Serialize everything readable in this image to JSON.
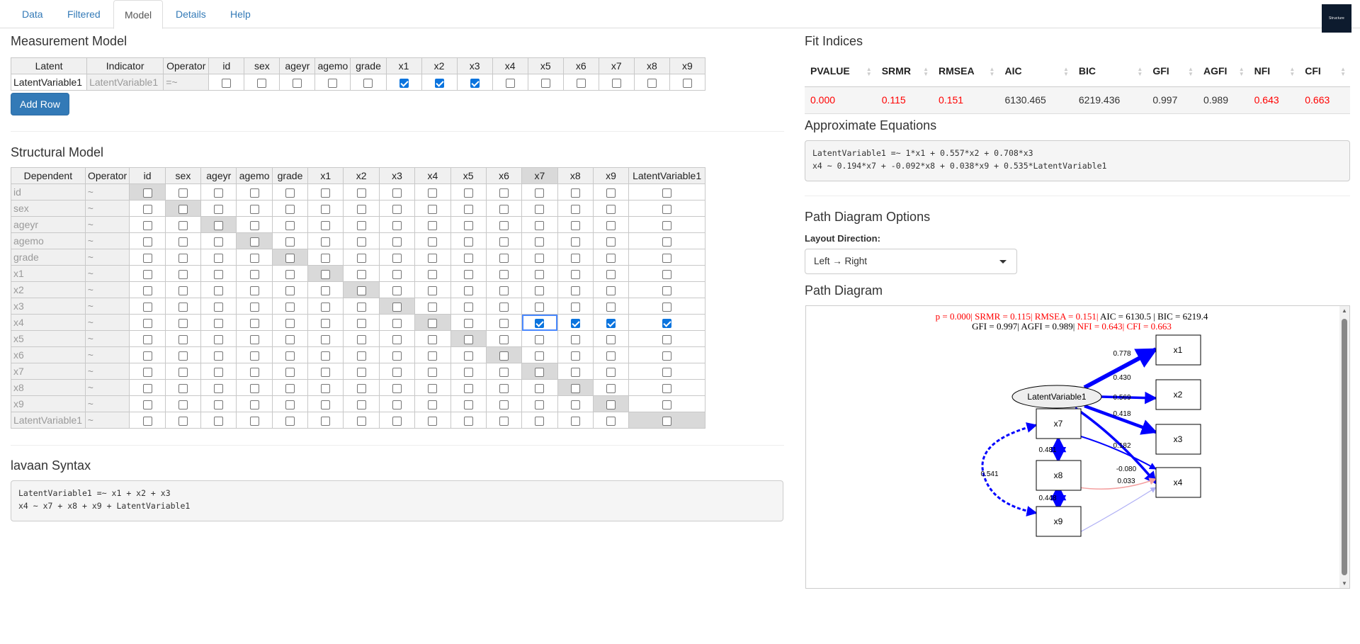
{
  "tabs": [
    "Data",
    "Filtered",
    "Model",
    "Details",
    "Help"
  ],
  "active_tab": "Model",
  "logo_text": "Structure",
  "measurement": {
    "title": "Measurement Model",
    "columns": [
      "Latent",
      "Indicator",
      "Operator",
      "id",
      "sex",
      "ageyr",
      "agemo",
      "grade",
      "x1",
      "x2",
      "x3",
      "x4",
      "x5",
      "x6",
      "x7",
      "x8",
      "x9"
    ],
    "row": {
      "latent": "LatentVariable1",
      "indicator": "LatentVariable1",
      "operator": "=~",
      "checks": [
        false,
        false,
        false,
        false,
        false,
        true,
        true,
        true,
        false,
        false,
        false,
        false,
        false,
        false
      ]
    },
    "add_row_label": "Add Row"
  },
  "structural": {
    "title": "Structural Model",
    "columns": [
      "Dependent",
      "Operator",
      "id",
      "sex",
      "ageyr",
      "agemo",
      "grade",
      "x1",
      "x2",
      "x3",
      "x4",
      "x5",
      "x6",
      "x7",
      "x8",
      "x9",
      "LatentVariable1"
    ],
    "operator": "~",
    "rows": [
      "id",
      "sex",
      "ageyr",
      "agemo",
      "grade",
      "x1",
      "x2",
      "x3",
      "x4",
      "x5",
      "x6",
      "x7",
      "x8",
      "x9",
      "LatentVariable1"
    ],
    "checked": {
      "x4": [
        "x7",
        "x8",
        "x9",
        "LatentVariable1"
      ]
    },
    "selected_cell": {
      "row": "x4",
      "col": "x7"
    }
  },
  "syntax": {
    "title": "lavaan Syntax",
    "lines": [
      "LatentVariable1 =~ x1 + x2 + x3",
      "x4 ~ x7 + x8 + x9 + LatentVariable1"
    ]
  },
  "fit": {
    "title": "Fit Indices",
    "headers": [
      "PVALUE",
      "SRMR",
      "RMSEA",
      "AIC",
      "BIC",
      "GFI",
      "AGFI",
      "NFI",
      "CFI"
    ],
    "values": [
      "0.000",
      "0.115",
      "0.151",
      "6130.465",
      "6219.436",
      "0.997",
      "0.989",
      "0.643",
      "0.663"
    ],
    "flagged": [
      true,
      true,
      true,
      false,
      false,
      false,
      false,
      true,
      true
    ],
    "flag_color": "#ff0000"
  },
  "equations": {
    "title": "Approximate Equations",
    "lines": [
      "LatentVariable1 =~ 1*x1 + 0.557*x2 + 0.708*x3",
      "x4 ~ 0.194*x7 + -0.092*x8 + 0.038*x9 + 0.535*LatentVariable1"
    ]
  },
  "options": {
    "title": "Path Diagram Options",
    "layout_label": "Layout Direction:",
    "layout_value": "Left → Right"
  },
  "diagram": {
    "title": "Path Diagram",
    "stats_line1": [
      {
        "t": "p = 0.000| ",
        "c": "#ff0000"
      },
      {
        "t": "SRMR = 0.115| ",
        "c": "#ff0000"
      },
      {
        "t": "RMSEA = 0.151| ",
        "c": "#ff0000"
      },
      {
        "t": "AIC = 6130.5 | BIC = 6219.4",
        "c": "#000000"
      }
    ],
    "stats_line2": [
      {
        "t": "GFI = 0.997| ",
        "c": "#000000"
      },
      {
        "t": "AGFI = 0.989| ",
        "c": "#000000"
      },
      {
        "t": "NFI = 0.643| ",
        "c": "#ff0000"
      },
      {
        "t": "CFI = 0.663",
        "c": "#ff0000"
      }
    ],
    "latent": "LatentVariable1",
    "nodes": [
      "x1",
      "x2",
      "x3",
      "x4",
      "x7",
      "x8",
      "x9"
    ],
    "loadings": [
      "0.778",
      "0.430",
      "0.569",
      "0.418"
    ],
    "regressions": [
      "0.182",
      "-0.080",
      "0.033"
    ],
    "covariances": [
      "0.481",
      "0.541",
      "0.448"
    ]
  }
}
